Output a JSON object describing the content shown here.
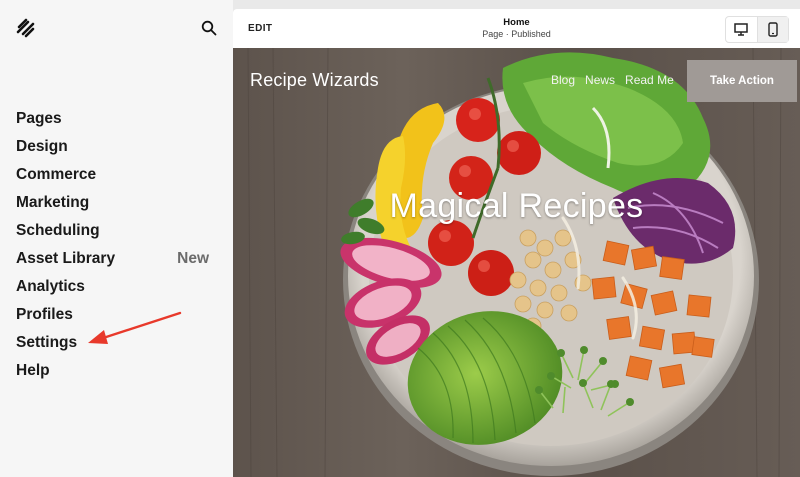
{
  "sidebar": {
    "logo_icon": "squarespace-logo-icon",
    "search_icon": "search-icon",
    "items": [
      {
        "label": "Pages",
        "badge": ""
      },
      {
        "label": "Design",
        "badge": ""
      },
      {
        "label": "Commerce",
        "badge": ""
      },
      {
        "label": "Marketing",
        "badge": ""
      },
      {
        "label": "Scheduling",
        "badge": ""
      },
      {
        "label": "Asset Library",
        "badge": "New"
      },
      {
        "label": "Analytics",
        "badge": ""
      },
      {
        "label": "Profiles",
        "badge": ""
      },
      {
        "label": "Settings",
        "badge": ""
      },
      {
        "label": "Help",
        "badge": ""
      }
    ],
    "annotation_arrow_color": "#e8392b"
  },
  "topbar": {
    "edit_label": "EDIT",
    "page_title": "Home",
    "page_status": "Page · Published",
    "device_icons": [
      "desktop-icon",
      "mobile-icon"
    ]
  },
  "site": {
    "name": "Recipe Wizards",
    "nav": [
      "Blog",
      "News",
      "Read Me"
    ],
    "cta": "Take Action",
    "headline": "Magical Recipes",
    "cta_color": "#a09a96"
  }
}
